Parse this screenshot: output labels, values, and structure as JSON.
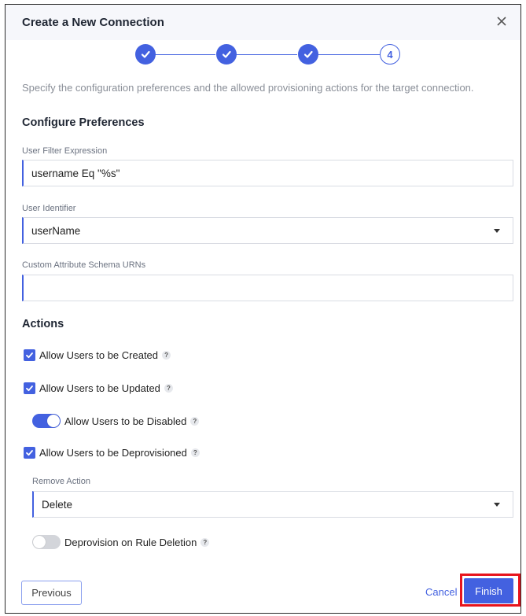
{
  "dialog": {
    "title": "Create a New Connection",
    "close_icon": "close-icon"
  },
  "stepper": {
    "steps": [
      {
        "state": "completed",
        "icon": "check-icon"
      },
      {
        "state": "completed",
        "icon": "check-icon"
      },
      {
        "state": "completed",
        "icon": "check-icon"
      },
      {
        "state": "active",
        "label": "4"
      }
    ],
    "current_step": 4,
    "total_steps": 4
  },
  "description": "Specify the configuration preferences and the allowed provisioning actions for the target connection.",
  "preferences": {
    "heading": "Configure Preferences",
    "user_filter": {
      "label": "User Filter Expression",
      "value": "username Eq \"%s\""
    },
    "user_identifier": {
      "label": "User Identifier",
      "value": "userName"
    },
    "custom_schema": {
      "label": "Custom Attribute Schema URNs",
      "value": ""
    }
  },
  "actions": {
    "heading": "Actions",
    "allow_create": {
      "label": "Allow Users to be Created",
      "checked": true,
      "help": "?"
    },
    "allow_update": {
      "label": "Allow Users to be Updated",
      "checked": true,
      "help": "?"
    },
    "allow_disable": {
      "label": "Allow Users to be Disabled",
      "on": true,
      "help": "?"
    },
    "allow_deprovision": {
      "label": "Allow Users to be Deprovisioned",
      "checked": true,
      "help": "?"
    },
    "remove_action": {
      "label": "Remove Action",
      "value": "Delete"
    },
    "deprovision_on_rule_deletion": {
      "label": "Deprovision on Rule Deletion",
      "on": false,
      "help": "?"
    }
  },
  "footer": {
    "previous_label": "Previous",
    "cancel_label": "Cancel",
    "finish_label": "Finish"
  },
  "colors": {
    "accent": "#4361e0",
    "highlight": "#e8141c"
  }
}
